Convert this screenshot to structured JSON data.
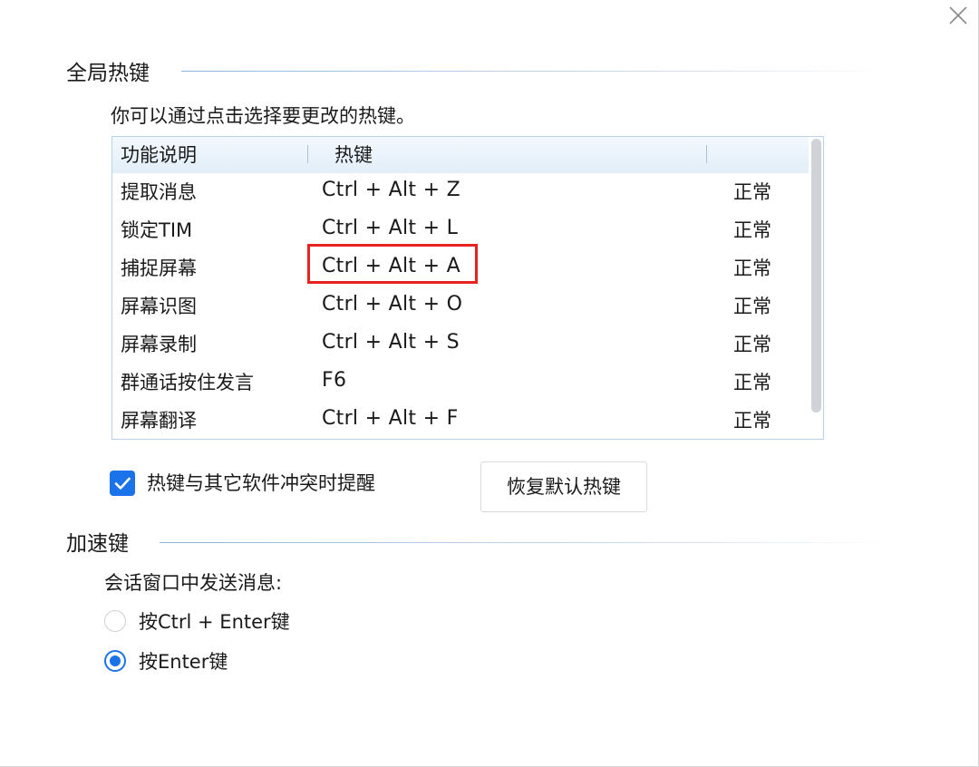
{
  "dialog": {
    "close_icon": "close-icon"
  },
  "global_hotkeys": {
    "title": "全局热键",
    "hint": "你可以通过点击选择要更改的热键。",
    "columns": [
      "功能说明",
      "热键",
      ""
    ],
    "rows": [
      {
        "function": "提取消息",
        "hotkey": "Ctrl + Alt + Z",
        "status": "正常"
      },
      {
        "function": "锁定TIM",
        "hotkey": "Ctrl + Alt + L",
        "status": "正常"
      },
      {
        "function": "捕捉屏幕",
        "hotkey": "Ctrl + Alt + A",
        "status": "正常"
      },
      {
        "function": "屏幕识图",
        "hotkey": "Ctrl + Alt + O",
        "status": "正常"
      },
      {
        "function": "屏幕录制",
        "hotkey": "Ctrl + Alt + S",
        "status": "正常"
      },
      {
        "function": "群通话按住发言",
        "hotkey": "F6",
        "status": "正常"
      },
      {
        "function": "屏幕翻译",
        "hotkey": "Ctrl + Alt + F",
        "status": "正常"
      }
    ],
    "highlighted_row": 2,
    "highlight_color": "#e8231f",
    "conflict_alert": {
      "label": "热键与其它软件冲突时提醒",
      "checked": true
    },
    "restore_button": "恢复默认热键"
  },
  "accelerators": {
    "title": "加速键",
    "send_message_label": "会话窗口中发送消息:",
    "options": [
      {
        "label": "按Ctrl + Enter键",
        "selected": false
      },
      {
        "label": "按Enter键",
        "selected": true
      }
    ]
  },
  "colors": {
    "accent": "#1a73e8",
    "header_bg": "#e2eef9",
    "table_border": "#b9d3ea"
  }
}
